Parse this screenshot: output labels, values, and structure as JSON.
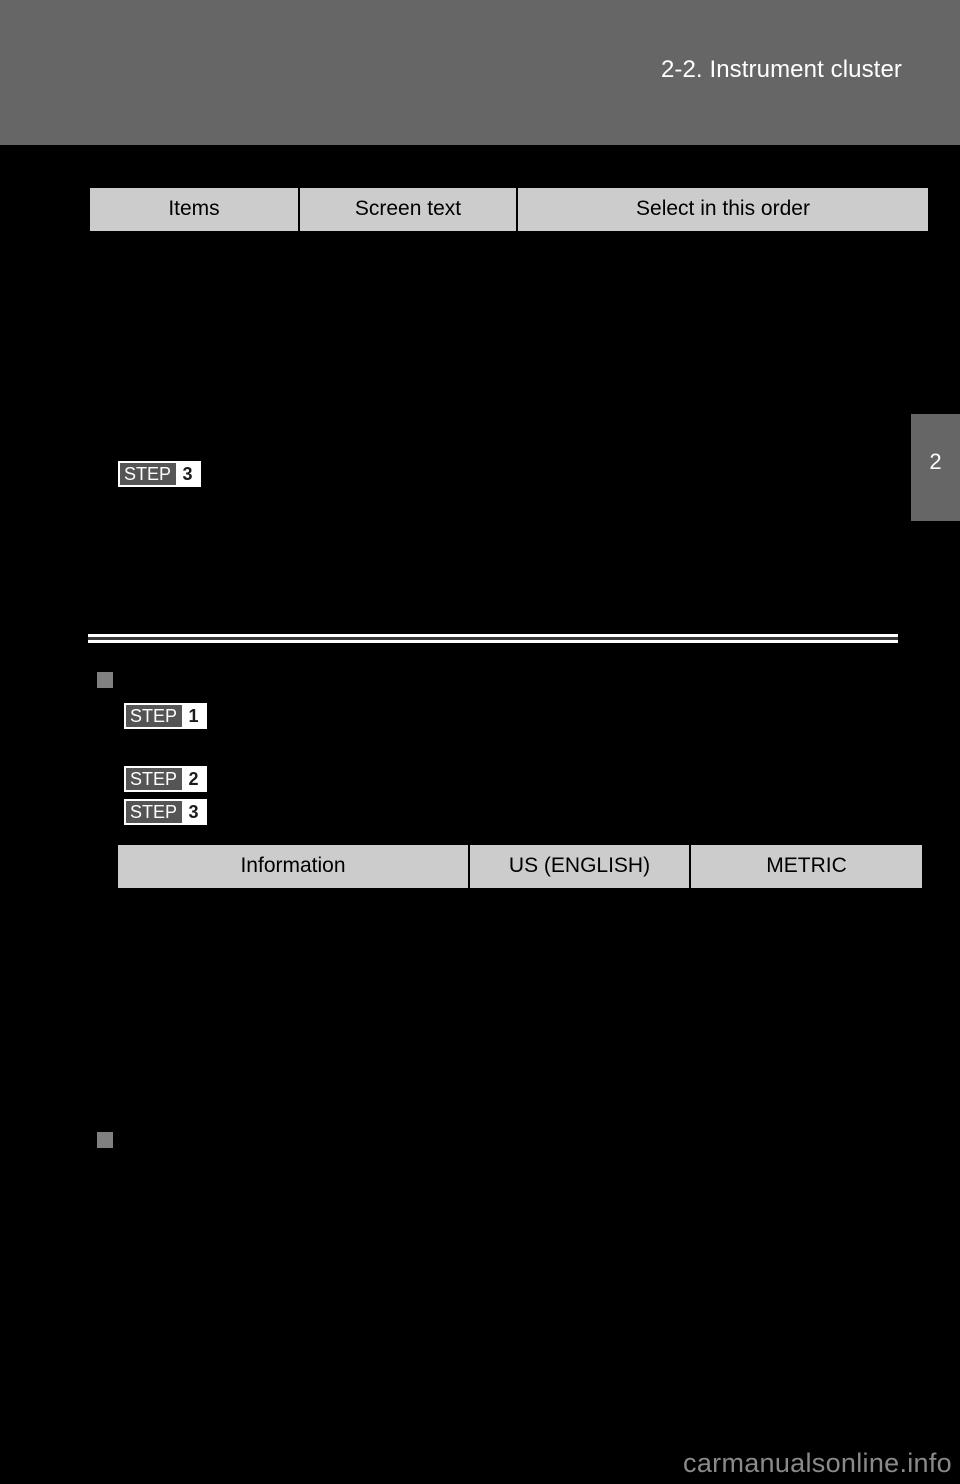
{
  "page": {
    "background_color": "#000000",
    "header_band_color": "#666666",
    "table_header_fill": "#cccccc",
    "bullet_color": "#808080"
  },
  "header": {
    "title": "2-2. Instrument cluster"
  },
  "chapter_tab": {
    "number": "2"
  },
  "tables": [
    {
      "name": "multi-information-display-settings",
      "columns": [
        "Items",
        "Screen text",
        "Select in this order"
      ]
    },
    {
      "name": "units-information",
      "columns": [
        "Information",
        "US (ENGLISH)",
        "METRIC"
      ]
    }
  ],
  "steps": {
    "top": {
      "word": "STEP",
      "number": "3"
    },
    "one": {
      "word": "STEP",
      "number": "1"
    },
    "two": {
      "word": "STEP",
      "number": "2"
    },
    "three": {
      "word": "STEP",
      "number": "3"
    }
  },
  "footer": {
    "watermark": "carmanualsonline.info"
  }
}
